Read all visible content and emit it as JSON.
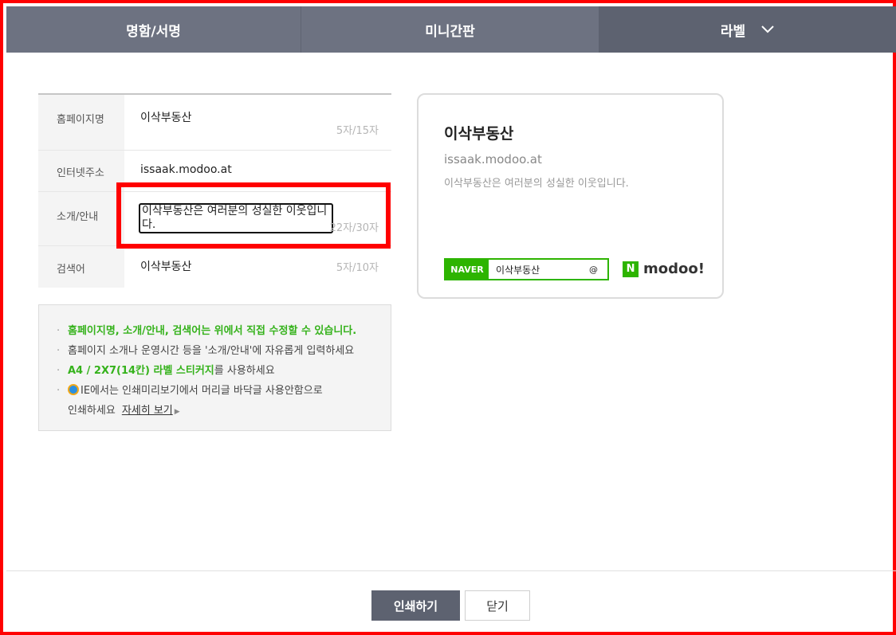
{
  "tabs": [
    {
      "label": "명함/서명"
    },
    {
      "label": "미니간판"
    },
    {
      "label": "라벨"
    }
  ],
  "form": {
    "rows": [
      {
        "label": "홈페이지명",
        "value": "이삭부동산",
        "count": "5자/15자"
      },
      {
        "label": "인터넷주소",
        "value": "issaak.modoo.at"
      },
      {
        "label": "소개/안내",
        "value": "이삭부동산은 여러분의 성실한 이웃입니다.",
        "count": "22자/30자"
      },
      {
        "label": "검색어",
        "value": "이삭부동산",
        "count": "5자/10자"
      }
    ]
  },
  "info": {
    "line1": "홈페이지명, 소개/안내, 검색어는 위에서 직접 수정할 수 있습니다.",
    "line2": "홈페이지 소개나 운영시간 등을 '소개/안내'에 자유롭게 입력하세요",
    "line3_bold": "A4 / 2X7(14칸) 라벨 스티커지",
    "line3_rest": "를 사용하세요",
    "line4": "IE에서는 인쇄미리보기에서 머리글 바닥글 사용안함으로",
    "line5": "인쇄하세요",
    "link": "자세히 보기"
  },
  "preview": {
    "title": "이삭부동산",
    "url": "issaak.modoo.at",
    "desc": "이삭부동산은 여러분의 성실한 이웃입니다.",
    "search_badge": "NAVER",
    "search_query": "이삭부동산",
    "search_at": "@",
    "brand_letter": "N",
    "brand_word": "modoo!"
  },
  "buttons": {
    "print": "인쇄하기",
    "close": "닫기"
  },
  "colors": {
    "accent_green": "#2db400",
    "tab_bg": "#6d7281",
    "highlight": "#ff0000"
  }
}
